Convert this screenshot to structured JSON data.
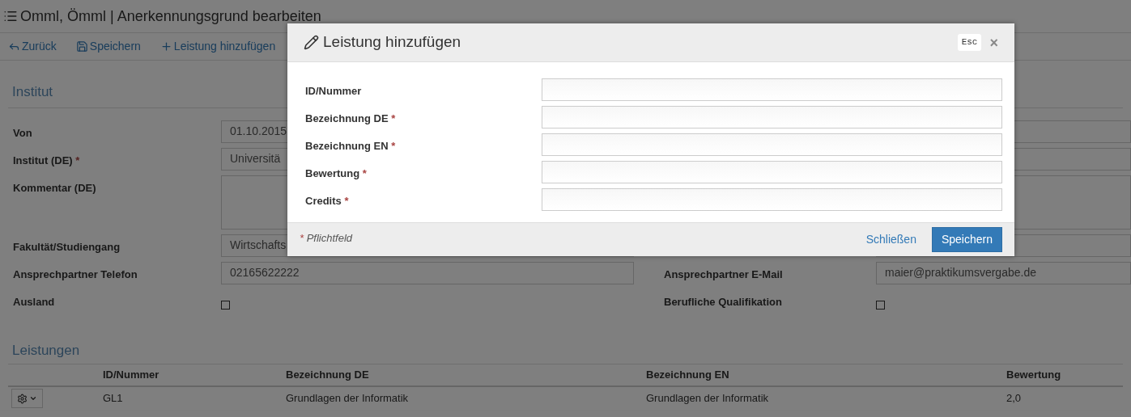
{
  "page": {
    "title": "Omml, Ömml | Anerkennungsgrund bearbeiten"
  },
  "toolbar": [
    {
      "kind": "back",
      "label": "Zurück"
    },
    {
      "kind": "save",
      "label": "Speichern"
    },
    {
      "kind": "add",
      "label": "Leistung hinzufügen"
    }
  ],
  "institut": {
    "heading": "Institut",
    "rows": [
      {
        "left": {
          "kind": "input",
          "label": "Von",
          "value": "01.10.2015"
        },
        "right": {
          "kind": "input"
        }
      },
      {
        "left": {
          "kind": "input",
          "label": "Institut (DE)",
          "mark": "*",
          "value": "Universitä"
        },
        "right": {
          "kind": "input"
        }
      },
      {
        "left": {
          "kind": "textarea",
          "label": "Kommentar (DE)"
        },
        "right": {
          "kind": "textarea"
        }
      },
      {
        "left": {
          "kind": "input",
          "label": "Fakultät/Studiengang",
          "value": "Wirtschafts"
        },
        "right": {
          "kind": "input"
        }
      },
      {
        "left": {
          "kind": "input",
          "label": "Ansprechpartner Telefon",
          "value": "02165622222"
        },
        "right": {
          "kind": "input",
          "label": "Ansprechpartner E-Mail",
          "value": "maier@praktikumsvergabe.de"
        }
      },
      {
        "left": {
          "kind": "checkbox",
          "label": "Ausland",
          "checked": false
        },
        "right": {
          "kind": "checkbox",
          "label": "Berufliche Qualifikation",
          "checked": false
        }
      }
    ]
  },
  "leistungen": {
    "heading": "Leistungen",
    "columns": [
      "ID/Nummer",
      "Bezeichnung DE",
      "Bezeichnung EN",
      "Bewertung"
    ],
    "rows": [
      {
        "cells": [
          "GL1",
          "Grundlagen der Informatik",
          "Grundlagen der Informatik",
          "2,0"
        ]
      }
    ]
  },
  "modal": {
    "title": "Leistung hinzufügen",
    "esc": "Esc",
    "close": "×",
    "fields": [
      {
        "label": "ID/Nummer"
      },
      {
        "label": "Bezeichnung DE",
        "mark": "*"
      },
      {
        "label": "Bezeichnung EN",
        "mark": "*"
      },
      {
        "label": "Bewertung",
        "mark": "*"
      },
      {
        "label": "Credits",
        "mark": "*"
      }
    ],
    "footnote": {
      "mark": "*",
      "text": "Pflichtfeld"
    },
    "buttons": [
      {
        "kind": "link",
        "label": "Schließen"
      },
      {
        "kind": "primary",
        "label": "Speichern"
      }
    ]
  }
}
